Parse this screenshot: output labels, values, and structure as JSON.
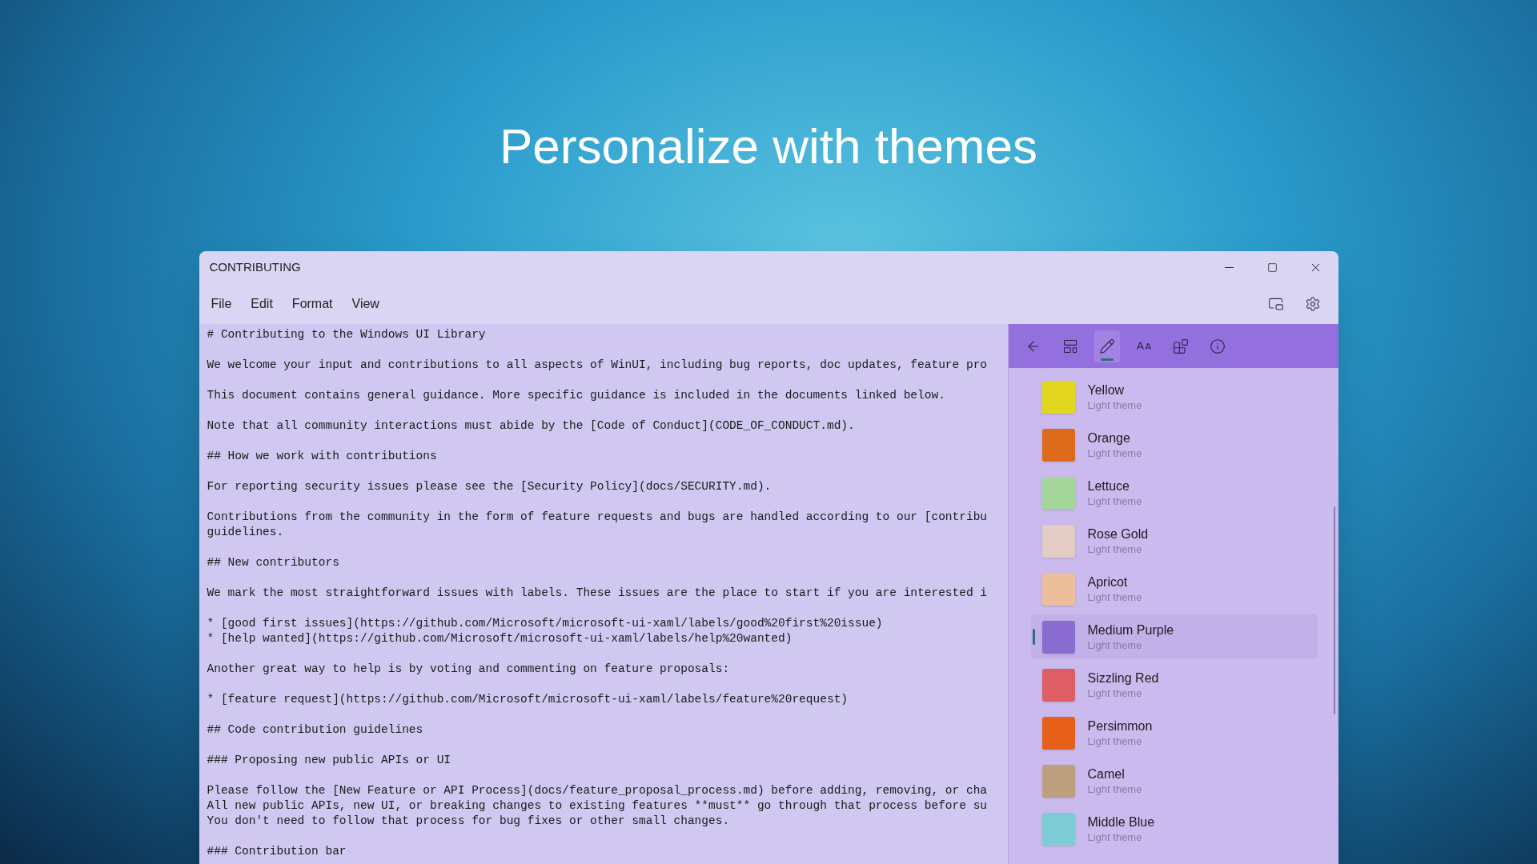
{
  "headline": "Personalize with themes",
  "window": {
    "title": "CONTRIBUTING"
  },
  "menu": [
    "File",
    "Edit",
    "Format",
    "View"
  ],
  "toolbar": [
    {
      "kind": "compact"
    },
    {
      "kind": "settings"
    }
  ],
  "editor": {
    "paragraphs": [
      [
        "# Contributing to the Windows UI Library"
      ],
      [
        "We welcome your input and contributions to all aspects of WinUI, including bug reports, doc updates, feature pro"
      ],
      [
        "This document contains general guidance. More specific guidance is included in the documents linked below."
      ],
      [
        "Note that all community interactions must abide by the [Code of Conduct](CODE_OF_CONDUCT.md)."
      ],
      [
        "## How we work with contributions"
      ],
      [
        "For reporting security issues please see the [Security Policy](docs/SECURITY.md)."
      ],
      [
        "Contributions from the community in the form of feature requests and bugs are handled according to our [contribu",
        "guidelines."
      ],
      [
        "## New contributors"
      ],
      [
        "We mark the most straightforward issues with labels. These issues are the place to start if you are interested i"
      ],
      [
        "* [good first issues](https://github.com/Microsoft/microsoft-ui-xaml/labels/good%20first%20issue)",
        "* [help wanted](https://github.com/Microsoft/microsoft-ui-xaml/labels/help%20wanted)"
      ],
      [
        "Another great way to help is by voting and commenting on feature proposals:"
      ],
      [
        "* [feature request](https://github.com/Microsoft/microsoft-ui-xaml/labels/feature%20request)"
      ],
      [
        "## Code contribution guidelines"
      ],
      [
        "### Proposing new public APIs or UI"
      ],
      [
        "Please follow the [New Feature or API Process](docs/feature_proposal_process.md) before adding, removing, or cha",
        "All new public APIs, new UI, or breaking changes to existing features **must** go through that process before su",
        "You don't need to follow that process for bug fixes or other small changes."
      ],
      [
        "### Contribution bar"
      ]
    ]
  },
  "panel": {
    "tabs": [
      {
        "kind": "back",
        "selected": false
      },
      {
        "kind": "layout",
        "selected": false
      },
      {
        "kind": "pen",
        "selected": true
      },
      {
        "kind": "font",
        "selected": false
      },
      {
        "kind": "add",
        "selected": false
      },
      {
        "kind": "info",
        "selected": false
      }
    ],
    "themes": [
      {
        "name": "Yellow",
        "subtitle": "Light theme",
        "color": "#e3d61e",
        "selected": false
      },
      {
        "name": "Orange",
        "subtitle": "Light theme",
        "color": "#de6a1c",
        "selected": false
      },
      {
        "name": "Lettuce",
        "subtitle": "Light theme",
        "color": "#a4d69c",
        "selected": false
      },
      {
        "name": "Rose Gold",
        "subtitle": "Light theme",
        "color": "#e4ccc6",
        "selected": false
      },
      {
        "name": "Apricot",
        "subtitle": "Light theme",
        "color": "#ecbe9c",
        "selected": false
      },
      {
        "name": "Medium Purple",
        "subtitle": "Light theme",
        "color": "#8a6cd0",
        "selected": true
      },
      {
        "name": "Sizzling Red",
        "subtitle": "Light theme",
        "color": "#de5e66",
        "selected": false
      },
      {
        "name": "Persimmon",
        "subtitle": "Light theme",
        "color": "#e6601a",
        "selected": false
      },
      {
        "name": "Camel",
        "subtitle": "Light theme",
        "color": "#bd9e7e",
        "selected": false
      },
      {
        "name": "Middle Blue",
        "subtitle": "Light theme",
        "color": "#7ecdd6",
        "selected": false
      }
    ]
  }
}
